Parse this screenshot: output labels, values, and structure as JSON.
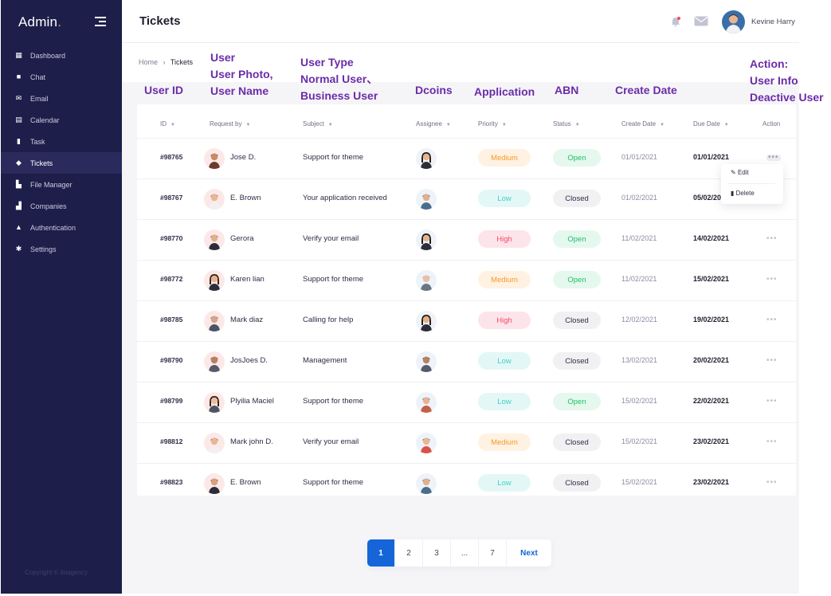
{
  "sidebar": {
    "brand": "Admin",
    "brand_dot": ".",
    "items": [
      {
        "label": "Dashboard",
        "icon": "dashboard-icon",
        "glyph": "▦"
      },
      {
        "label": "Chat",
        "icon": "chat-icon",
        "glyph": "■"
      },
      {
        "label": "Email",
        "icon": "email-icon",
        "glyph": "✉"
      },
      {
        "label": "Calendar",
        "icon": "calendar-icon",
        "glyph": "▤"
      },
      {
        "label": "Task",
        "icon": "task-icon",
        "glyph": "▮"
      },
      {
        "label": "Tickets",
        "icon": "ticket-icon",
        "glyph": "◆"
      },
      {
        "label": "File Manager",
        "icon": "file-icon",
        "glyph": "▙"
      },
      {
        "label": "Companies",
        "icon": "companies-icon",
        "glyph": "▟"
      },
      {
        "label": "Authentication",
        "icon": "lock-icon",
        "glyph": "▲"
      },
      {
        "label": "Settings",
        "icon": "gear-icon",
        "glyph": "✱"
      }
    ],
    "active": "Tickets",
    "copyright": "Copyright © itoagency"
  },
  "header": {
    "title": "Tickets",
    "username": "Kevine Harry"
  },
  "breadcrumb": {
    "home": "Home",
    "separator": "›",
    "current": "Tickets"
  },
  "annotations": {
    "user_id": "User ID",
    "user": [
      "User",
      "User Photo,",
      "User Name"
    ],
    "user_type": [
      "User Type",
      "Normal User、",
      "Business User"
    ],
    "dcoins": "Dcoins",
    "application": "Application",
    "abn": "ABN",
    "create_date": "Create Date",
    "action": [
      "Action:",
      "User Info",
      "Deactive User"
    ]
  },
  "table": {
    "columns": {
      "id": "ID",
      "request_by": "Request by",
      "subject": "Subject",
      "assignee": "Assignee",
      "priority": "Priority",
      "status": "Status",
      "create_date": "Create Date",
      "due_date": "Due Date",
      "action": "Action"
    },
    "rows": [
      {
        "id": "#98765",
        "name": "Jose D.",
        "subject": "Support for theme",
        "priority": "Medium",
        "status": "Open",
        "created": "01/01/2021",
        "due": "01/01/2021"
      },
      {
        "id": "#98767",
        "name": "E. Brown",
        "subject": "Your application received",
        "priority": "Low",
        "status": "Closed",
        "created": "01/02/2021",
        "due": "05/02/2021"
      },
      {
        "id": "#98770",
        "name": "Gerora",
        "subject": "Verify your email",
        "priority": "High",
        "status": "Open",
        "created": "11/02/2021",
        "due": "14/02/2021"
      },
      {
        "id": "#98772",
        "name": "Karen lian",
        "subject": "Support for theme",
        "priority": "Medium",
        "status": "Open",
        "created": "11/02/2021",
        "due": "15/02/2021"
      },
      {
        "id": "#98785",
        "name": "Mark diaz",
        "subject": "Calling for help",
        "priority": "High",
        "status": "Closed",
        "created": "12/02/2021",
        "due": "19/02/2021"
      },
      {
        "id": "#98790",
        "name": "JosJoes  D.",
        "subject": "Management",
        "priority": "Low",
        "status": "Closed",
        "created": "13/02/2021",
        "due": "20/02/2021"
      },
      {
        "id": "#98799",
        "name": "Plyilia Maciel",
        "subject": "Support for theme",
        "priority": "Low",
        "status": "Open",
        "created": "15/02/2021",
        "due": "22/02/2021"
      },
      {
        "id": "#98812",
        "name": "Mark john D.",
        "subject": "Verify your email",
        "priority": "Medium",
        "status": "Closed",
        "created": "15/02/2021",
        "due": "23/02/2021"
      },
      {
        "id": "#98823",
        "name": "E. Brown",
        "subject": "Support for theme",
        "priority": "Low",
        "status": "Closed",
        "created": "15/02/2021",
        "due": "23/02/2021"
      }
    ],
    "action_menu": {
      "edit": "Edit",
      "delete": "Delete"
    }
  },
  "pagination": {
    "pages": [
      "1",
      "2",
      "3",
      "...",
      "7"
    ],
    "current": "1",
    "next": "Next"
  },
  "colors": {
    "sidebar_bg": "#1e1e4a",
    "accent": "#1565d8",
    "annotation": "#6b2ca8"
  }
}
